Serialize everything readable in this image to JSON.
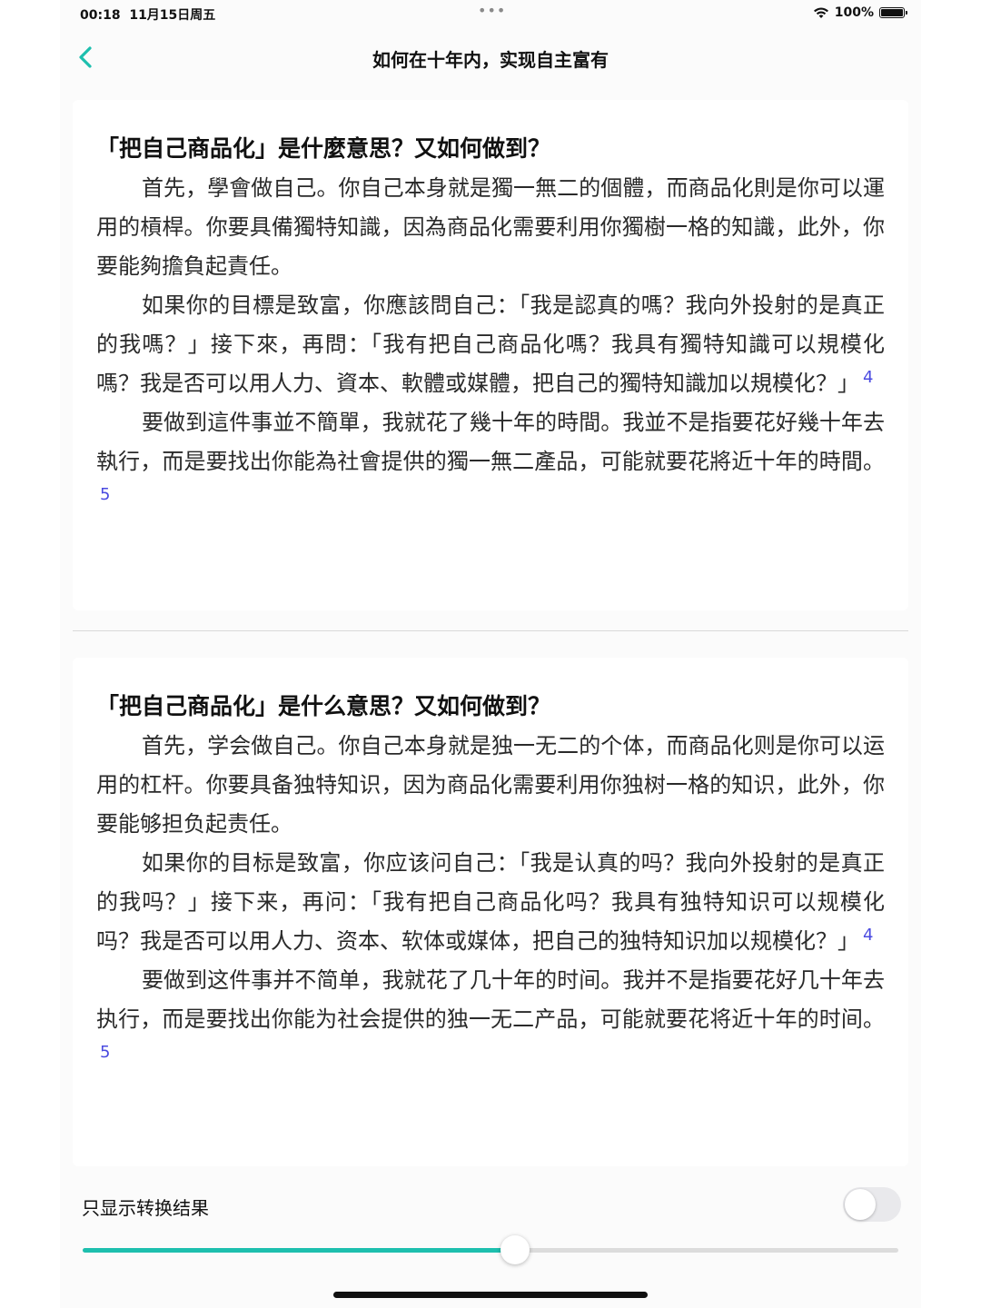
{
  "status_bar": {
    "time": "00:18",
    "date": "11月15日周五",
    "dots": "•••",
    "battery": "100%",
    "battery_level": 1.0,
    "wifi_icon": "wifi-icon",
    "battery_icon": "battery-icon"
  },
  "nav": {
    "back_icon": "chevron-left-icon",
    "title": "如何在十年内，实现自主富有"
  },
  "colors": {
    "accent": "#1dbfae",
    "footnote": "#4a4ae0",
    "background": "#fbfbfb",
    "card": "#ffffff"
  },
  "original": {
    "heading": "「把自己商品化」是什麼意思？又如何做到？",
    "p1": "首先，學會做自己。你自己本身就是獨一無二的個體，而商品化則是你可以運用的槓桿。你要具備獨特知識，因為商品化需要利用你獨樹一格的知識，此外，你要能夠擔負起責任。",
    "p2": "如果你的目標是致富，你應該問自己：「我是認真的嗎？我向外投射的是真正的我嗎？」接下來，再問：「我有把自己商品化嗎？我具有獨特知識可以規模化嗎？我是否可以用人力、資本、軟體或媒體，把自己的獨特知識加以規模化？」",
    "p2_note": "4",
    "p3": "要做到這件事並不簡單，我就花了幾十年的時間。我並不是指要花好幾十年去執行，而是要找出你能為社會提供的獨一無二產品，可能就要花將近十年的時間。",
    "p3_note": "5"
  },
  "converted": {
    "heading": "「把自己商品化」是什么意思？又如何做到？",
    "p1": "首先，学会做自己。你自己本身就是独一无二的个体，而商品化则是你可以运用的杠杆。你要具备独特知识，因为商品化需要利用你独树一格的知识，此外，你要能够担负起责任。",
    "p2": "如果你的目标是致富，你应该问自己：「我是认真的吗？我向外投射的是真正的我吗？」接下来，再问：「我有把自己商品化吗？我具有独特知识可以规模化吗？我是否可以用人力、资本、软体或媒体，把自己的独特知识加以规模化？」",
    "p2_note": "4",
    "p3": "要做到这件事并不简单，我就花了几十年的时间。我并不是指要花好几十年去执行，而是要找出你能为社会提供的独一无二产品，可能就要花将近十年的时间。",
    "p3_note": "5"
  },
  "controls": {
    "toggle_label": "只显示转换结果",
    "toggle_on": false,
    "slider_value": 0.53
  }
}
